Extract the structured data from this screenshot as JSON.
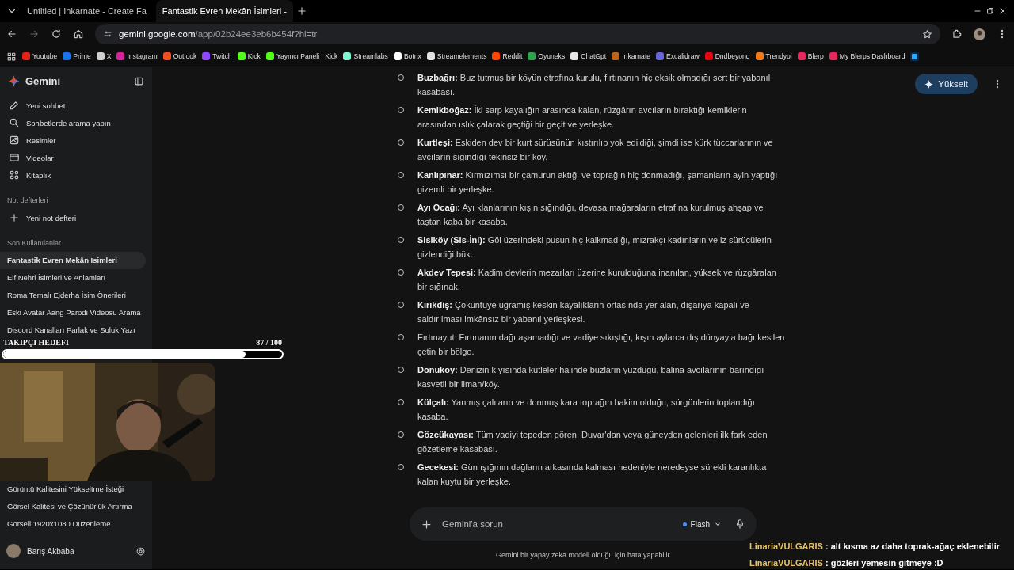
{
  "browser": {
    "tabs": [
      {
        "title": "Untitled | Inkarnate - Create Fa",
        "selected": false
      },
      {
        "title": "Fantastik Evren Mekân İsimleri -",
        "selected": true
      }
    ],
    "address": {
      "host": "gemini.google.com",
      "path": "/app/02b24ee3eb6b454f?hl=tr"
    },
    "bookmarks": [
      {
        "label": "Youtube",
        "color": "#e62117"
      },
      {
        "label": "Prime",
        "color": "#1a73e8"
      },
      {
        "label": "X",
        "color": "#d0d0d0"
      },
      {
        "label": "Instagram",
        "color": "#d6249f"
      },
      {
        "label": "Outlook",
        "color": "#f25022"
      },
      {
        "label": "Twitch",
        "color": "#9146ff"
      },
      {
        "label": "Kick",
        "color": "#53fc18"
      },
      {
        "label": "Yayıncı Paneli | Kick",
        "color": "#53fc18"
      },
      {
        "label": "Streamlabs",
        "color": "#80f5d2"
      },
      {
        "label": "Botrix",
        "color": "#ffffff"
      },
      {
        "label": "Streamelements",
        "color": "#e0e0e0"
      },
      {
        "label": "Reddit",
        "color": "#ff4500"
      },
      {
        "label": "Oyuneks",
        "color": "#2ea44f"
      },
      {
        "label": "ChatGpt",
        "color": "#e8e8e8"
      },
      {
        "label": "Inkarnate",
        "color": "#b5651d"
      },
      {
        "label": "Excalidraw",
        "color": "#6965db"
      },
      {
        "label": "Dndbeyond",
        "color": "#e40712"
      },
      {
        "label": "Trendyol",
        "color": "#f27a1a"
      },
      {
        "label": "Blerp",
        "color": "#e8275f"
      },
      {
        "label": "My Blerps Dashboard",
        "color": "#e8275f"
      }
    ]
  },
  "sidebar": {
    "brand": "Gemini",
    "nav": [
      {
        "label": "Yeni sohbet"
      },
      {
        "label": "Sohbetlerde arama yapın"
      },
      {
        "label": "Resimler"
      },
      {
        "label": "Videolar"
      },
      {
        "label": "Kitaplık"
      }
    ],
    "notebooks_heading": "Not defterleri",
    "new_notebook": "Yeni not defteri",
    "recents_heading": "Son Kullanılanlar",
    "recents": [
      {
        "title": "Fantastik Evren Mekân İsimleri",
        "selected": true
      },
      {
        "title": "Elf Nehri İsimleri ve Anlamları",
        "selected": false
      },
      {
        "title": "Roma Temalı Ejderha İsim Önerileri",
        "selected": false
      },
      {
        "title": "Eski Avatar Aang Parodi Videosu Arama",
        "selected": false
      },
      {
        "title": "Discord Kanalları Parlak ve Soluk Yazı",
        "selected": false
      },
      {
        "title": "Görüntü Kalitesini Yükseltme İsteği",
        "selected": false
      },
      {
        "title": "Görsel Kalitesi ve Çözünürlük Artırma",
        "selected": false
      },
      {
        "title": "Görseli 1920x1080 Düzenleme",
        "selected": false
      }
    ],
    "user": "Barış Akbaba"
  },
  "upgrade_button": "Yükselt",
  "answer": [
    "**Buzbağrı:** Buz tutmuş bir köyün etrafına kurulu, fırtınanın hiç eksik olmadığı sert bir yabanıl kasabası.",
    "**Kemikboğaz:** İki sarp kayalığın arasında kalan, rüzgârın avcıların bıraktığı kemiklerin arasından ıslık çalarak geçtiği bir geçit ve yerleşke.",
    "**Kurtleşi:** Eskiden dev bir kurt sürüsünün kıstırılıp yok edildiği, şimdi ise kürk tüccarlarının ve avcıların sığındığı tekinsiz bir köy.",
    "**Kanlıpınar:** Kırmızımsı bir çamurun aktığı ve toprağın hiç donmadığı, şamanların ayin yaptığı gizemli bir yerleşke.",
    "**Ayı Ocağı:** Ayı klanlarının kışın sığındığı, devasa mağaraların etrafına kurulmuş ahşap ve taştan kaba bir kasaba.",
    "**Sisiköy (Sis-İni):** Göl üzerindeki pusun hiç kalkmadığı, mızrakçı kadınların ve iz sürücülerin gizlendiği bük.",
    "**Akdev Tepesi:** Kadim devlerin mezarları üzerine kurulduğuna inanılan, yüksek ve rüzgâralan bir sığınak.",
    "**Kırıkdiş:** Çöküntüye uğramış keskin kayalıkların ortasında yer alan, dışarıya kapalı ve saldırılması imkânsız bir yabanıl yerleşkesi.",
    "Fırtınayut: Fırtınanın dağı aşamadığı ve vadiye sıkıştığı, kışın aylarca dış dünyayla bağı kesilen çetin bir bölge.",
    "**Donukoy:** Denizin kıyısında kütleler halinde buzların yüzdüğü, balina avcılarının barındığı kasvetli bir liman/köy.",
    "**Külçalı:** Yanmış çalıların ve donmuş kara toprağın hakim olduğu, sürgünlerin toplandığı kasaba.",
    "**Gözcükayası:** Tüm vadiyi tepeden gören, Duvar'dan veya güneyden gelenleri ilk fark eden gözetleme kasabası.",
    "**Gecekesi:** Gün ışığının dağların arkasında kalması nedeniyle neredeyse sürekli karanlıkta kalan kuytu bir yerleşke."
  ],
  "prompt": {
    "placeholder": "Gemini'a sorun",
    "model": "Flash"
  },
  "disclaimer": "Gemini bir yapay zeka modeli olduğu için hata yapabilir.",
  "overlay": {
    "goal_label": "TAKIPÇI HEDEFI",
    "goal_count": "87 / 100",
    "level": 0.87,
    "chat": [
      {
        "user": "LinariaVULGARIS",
        "text": ": alt kısma az daha toprak-ağaç eklenebilir"
      },
      {
        "user": "LinariaVULGARIS",
        "text": ": gözleri yemesin gitmeye :D"
      }
    ]
  }
}
